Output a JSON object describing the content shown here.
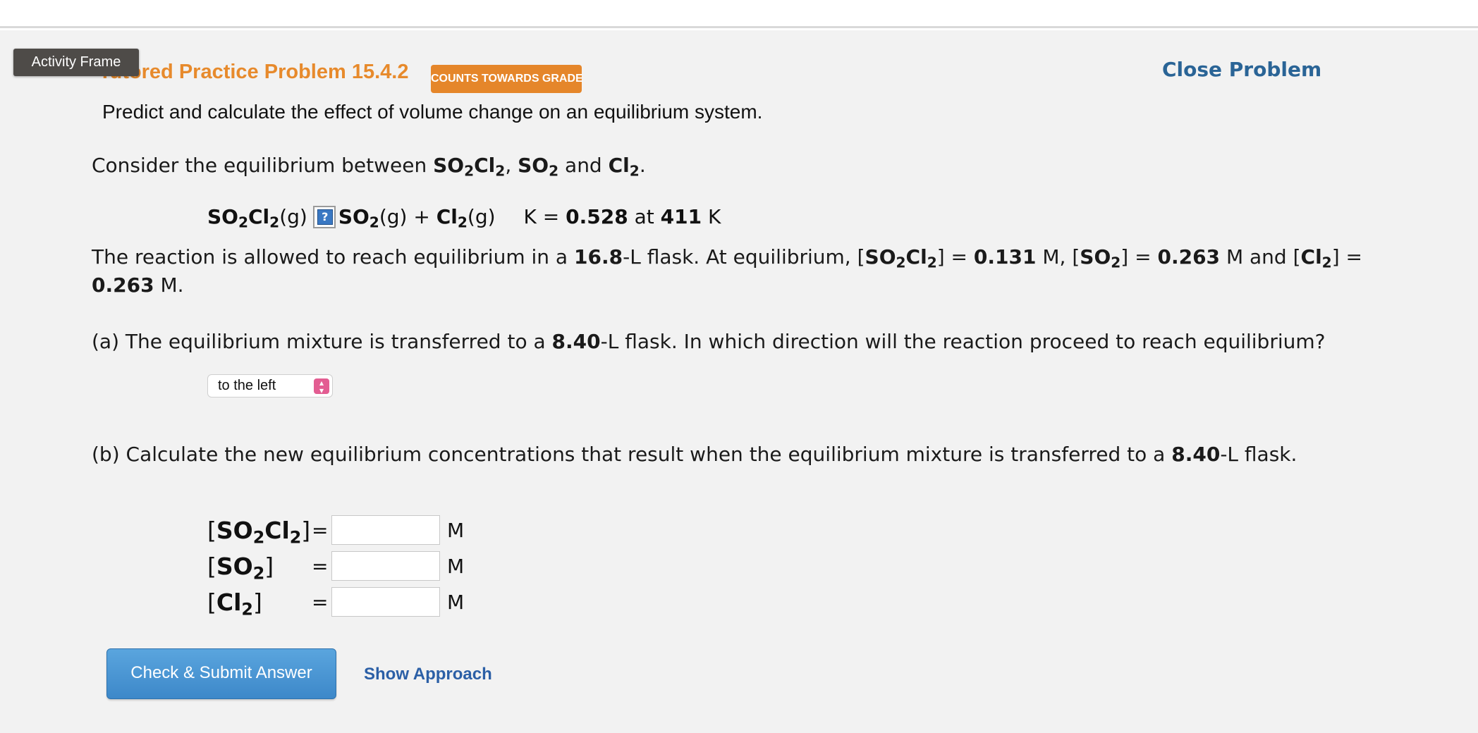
{
  "frame": {
    "tag_label": "Activity Frame"
  },
  "header": {
    "title": "Tutored Practice Problem 15.4.2",
    "badge": "COUNTS TOWARDS GRADE",
    "close_label": "Close Problem",
    "subtitle": "Predict and calculate the effect of volume change on an equilibrium system."
  },
  "problem": {
    "intro_text": "Consider the equilibrium between",
    "intro_and": "and",
    "species": {
      "so2cl2_a": "SO",
      "so2cl2_b": "2",
      "so2cl2_c": "Cl",
      "so2cl2_d": "2",
      "so2_a": "SO",
      "so2_b": "2",
      "cl2_a": "Cl",
      "cl2_b": "2"
    },
    "reaction": {
      "left_phase": "(g)",
      "help_glyph": "?",
      "right1_phase": "(g) + ",
      "right2_phase": "(g)",
      "k_prefix": "K = ",
      "k_value": "0.528",
      "k_at": " at ",
      "temp_value": "411",
      "temp_unit": " K"
    },
    "eq_text": {
      "p1": "The reaction is allowed to reach equilibrium in a ",
      "volume1": "16.8",
      "p2": "-L flask. At equilibrium, [",
      "p3": "] = ",
      "c_so2cl2": "0.131",
      "p4": " M, [",
      "p5": "] = ",
      "c_so2": "0.263",
      "p6": " M and [",
      "p7": "] =",
      "c_cl2": "0.263",
      "p8": " M."
    },
    "part_a": {
      "p1": "(a) The equilibrium mixture is transferred to a ",
      "volume": "8.40",
      "p2": "-L flask. In which direction will the reaction proceed to reach equilibrium?",
      "selected": "to the left"
    },
    "part_b": {
      "p1": "(b) Calculate the new equilibrium concentrations that result when the equilibrium mixture is transferred to a ",
      "volume": "8.40",
      "p2": "-L flask."
    },
    "answers": {
      "eq": "=",
      "unit": "M",
      "so2cl2_value": "",
      "so2_value": "",
      "cl2_value": ""
    }
  },
  "actions": {
    "submit_label": "Check & Submit Answer",
    "approach_label": "Show Approach"
  },
  "colors": {
    "title_orange": "#e78a2c",
    "badge_orange": "#e5862a",
    "link_blue": "#2a6496",
    "button_blue": "#3d88c9",
    "select_pink": "#e35d92"
  }
}
